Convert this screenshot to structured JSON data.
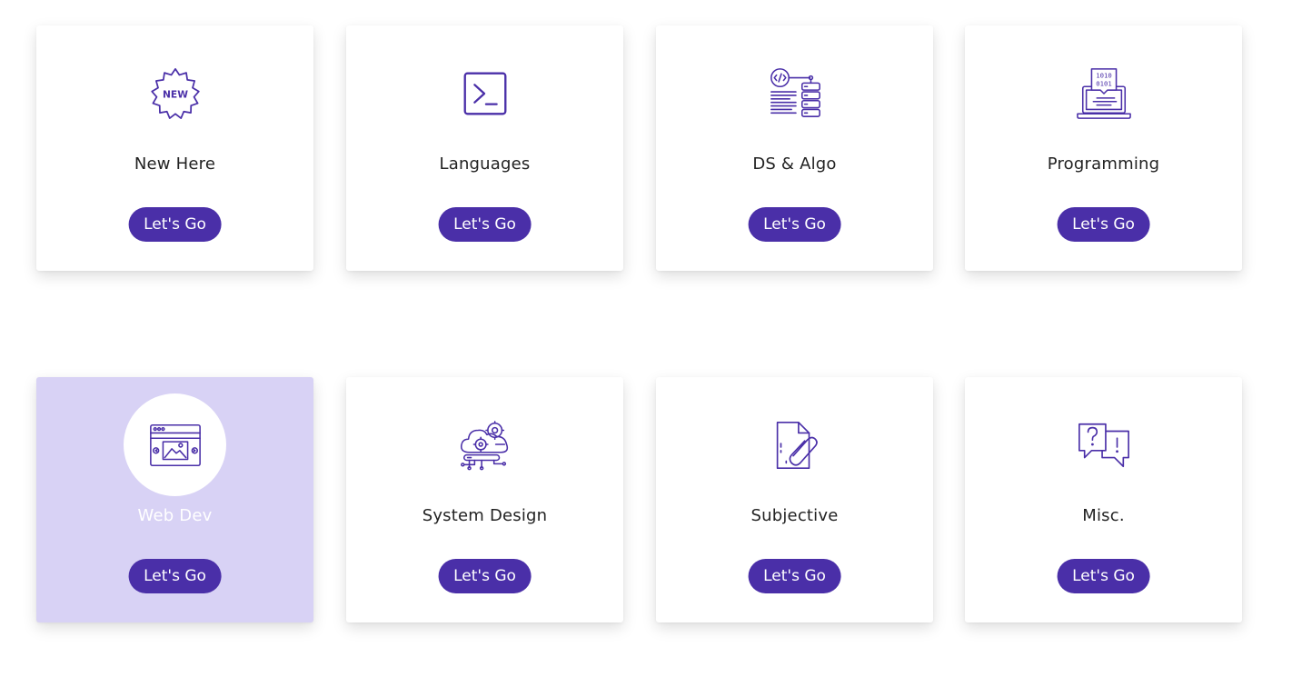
{
  "accent_color": "#4a2fa8",
  "active_card_bg": "#d8d2f5",
  "cards": [
    {
      "title": "New Here",
      "button_label": "Let's Go",
      "icon": "new-badge-icon"
    },
    {
      "title": "Languages",
      "button_label": "Let's Go",
      "icon": "terminal-icon"
    },
    {
      "title": "DS & Algo",
      "button_label": "Let's Go",
      "icon": "code-server-icon"
    },
    {
      "title": "Programming",
      "button_label": "Let's Go",
      "icon": "laptop-binary-icon"
    },
    {
      "title": "Web Dev",
      "button_label": "Let's Go",
      "icon": "browser-image-icon",
      "active": true
    },
    {
      "title": "System Design",
      "button_label": "Let's Go",
      "icon": "cloud-gears-icon"
    },
    {
      "title": "Subjective",
      "button_label": "Let's Go",
      "icon": "document-attachment-icon"
    },
    {
      "title": "Misc.",
      "button_label": "Let's Go",
      "icon": "question-chat-icon"
    }
  ]
}
